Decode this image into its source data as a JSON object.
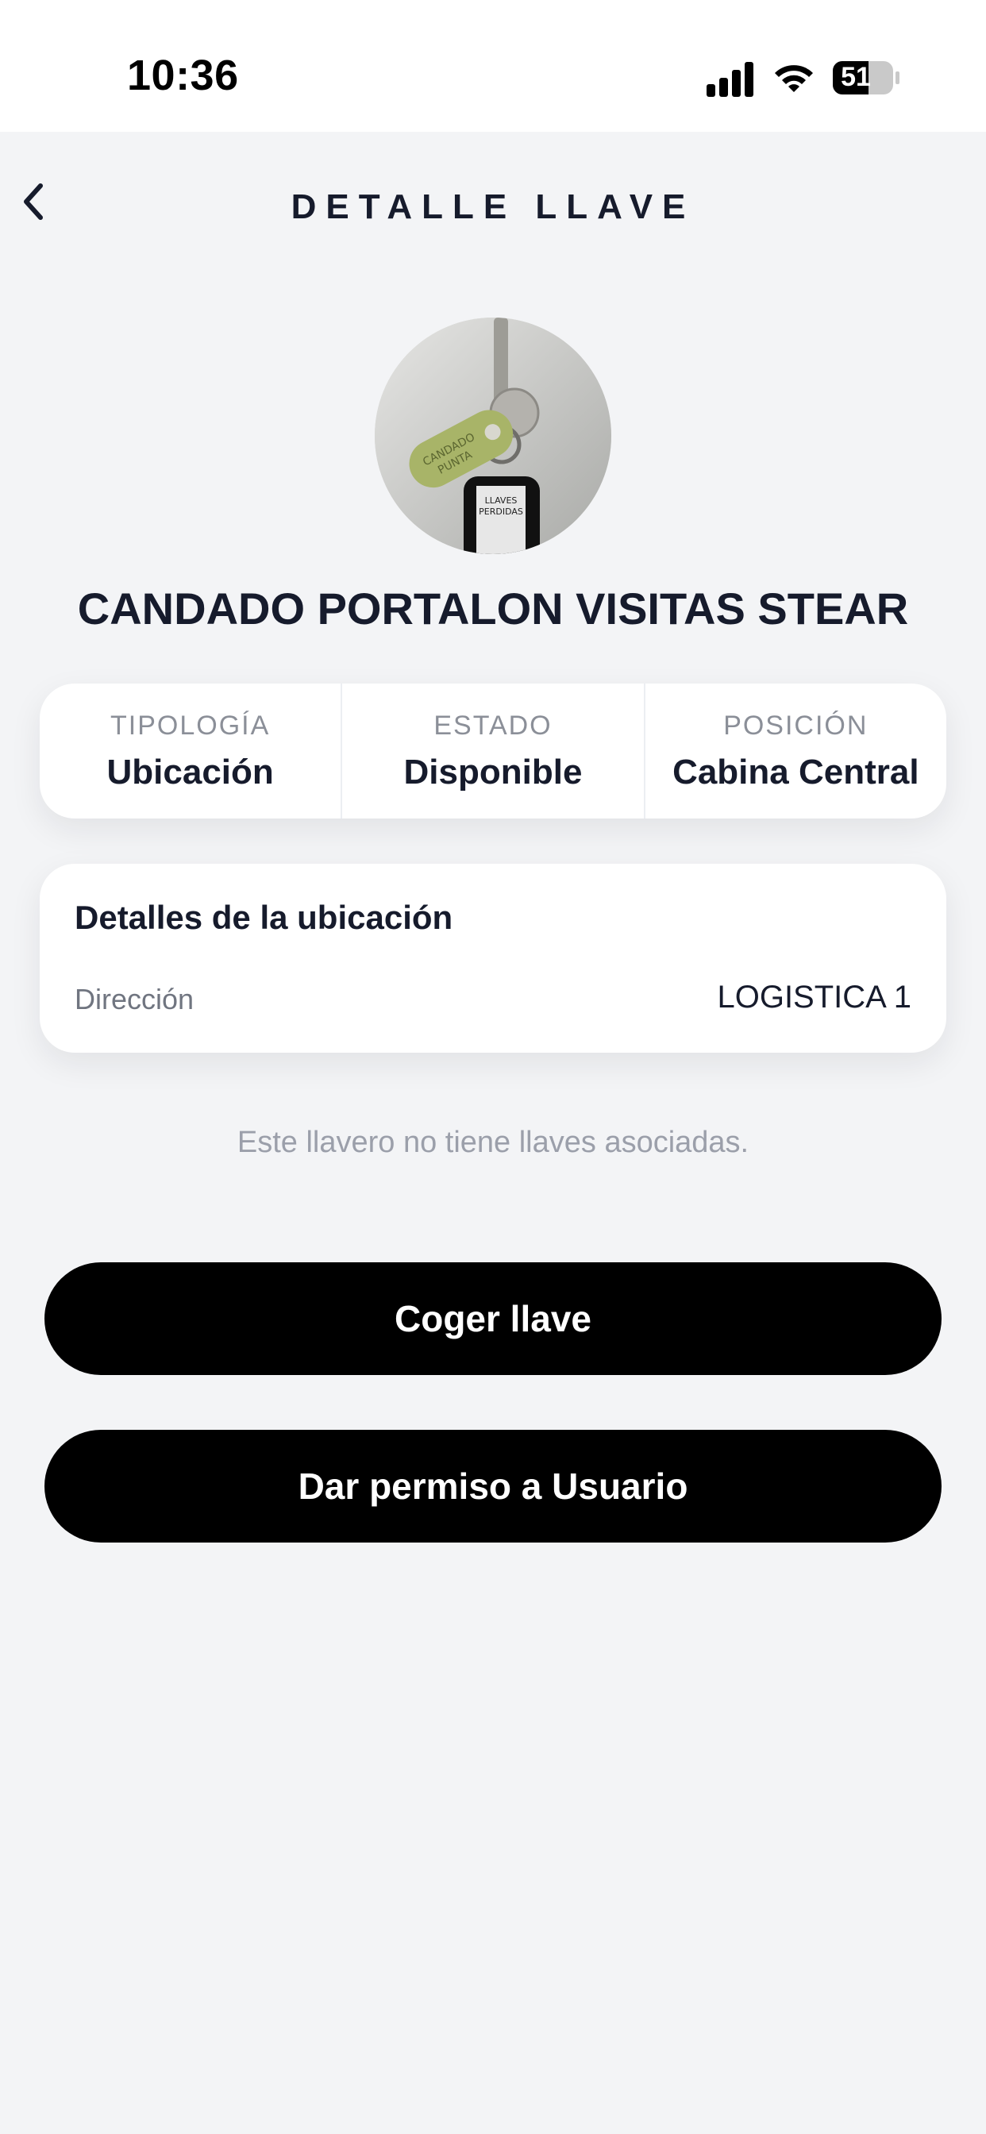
{
  "status_bar": {
    "time": "10:36",
    "battery_level": "51",
    "icons": [
      "signal-icon",
      "wifi-icon",
      "battery-icon"
    ]
  },
  "header": {
    "title": "DETALLE LLAVE",
    "back_icon": "chevron-left-icon"
  },
  "key": {
    "photo_description_icon": "key-photo",
    "name": "CANDADO PORTALON VISITAS STEAR"
  },
  "info": [
    {
      "label": "TIPOLOGÍA",
      "value": "Ubicación"
    },
    {
      "label": "ESTADO",
      "value": "Disponible"
    },
    {
      "label": "POSICIÓN",
      "value": "Cabina Central"
    }
  ],
  "location_details": {
    "title": "Detalles de la ubicación",
    "key": "Dirección",
    "value": "LOGISTICA 1"
  },
  "empty_note": "Este llavero no tiene llaves asociadas.",
  "actions": {
    "take_key": "Coger llave",
    "grant_permission": "Dar permiso a Usuario"
  },
  "colors": {
    "background": "#f3f4f6",
    "text_primary": "#161b2c",
    "button": "#000000"
  }
}
